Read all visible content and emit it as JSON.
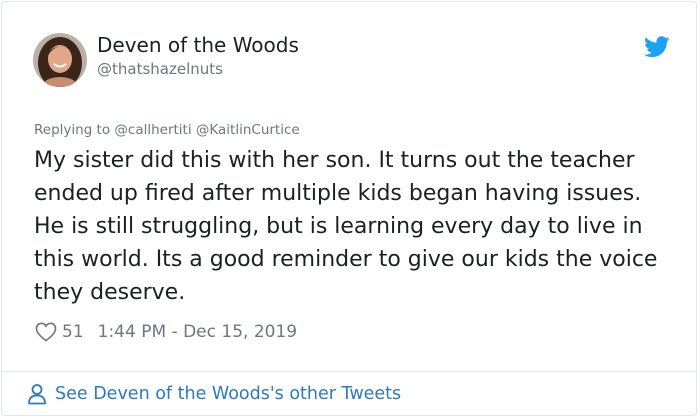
{
  "author": {
    "display_name": "Deven of the Woods",
    "handle": "@thatshazelnuts",
    "avatar_icon": "user-avatar-photo"
  },
  "reply": {
    "prefix": "Replying to",
    "mentions": [
      "@callhertiti",
      "@KaitlinCurtice"
    ]
  },
  "tweet": {
    "text": "My sister did this with her son. It turns out the teacher ended up fired after multiple kids began having issues. He is still struggling, but is learning every day to live in this world. Its a good reminder to give our kids the voice they deserve."
  },
  "meta": {
    "like_count": "51",
    "timestamp": "1:44 PM - Dec 15, 2019"
  },
  "footer": {
    "link_label": "See Deven of the Woods's other Tweets"
  },
  "colors": {
    "twitter_blue": "#1da1f2",
    "link_blue": "#2b7bb9",
    "secondary_text": "#697882",
    "border": "#e1e8ed"
  },
  "icons": [
    "twitter-bird-icon",
    "heart-icon",
    "person-icon"
  ]
}
